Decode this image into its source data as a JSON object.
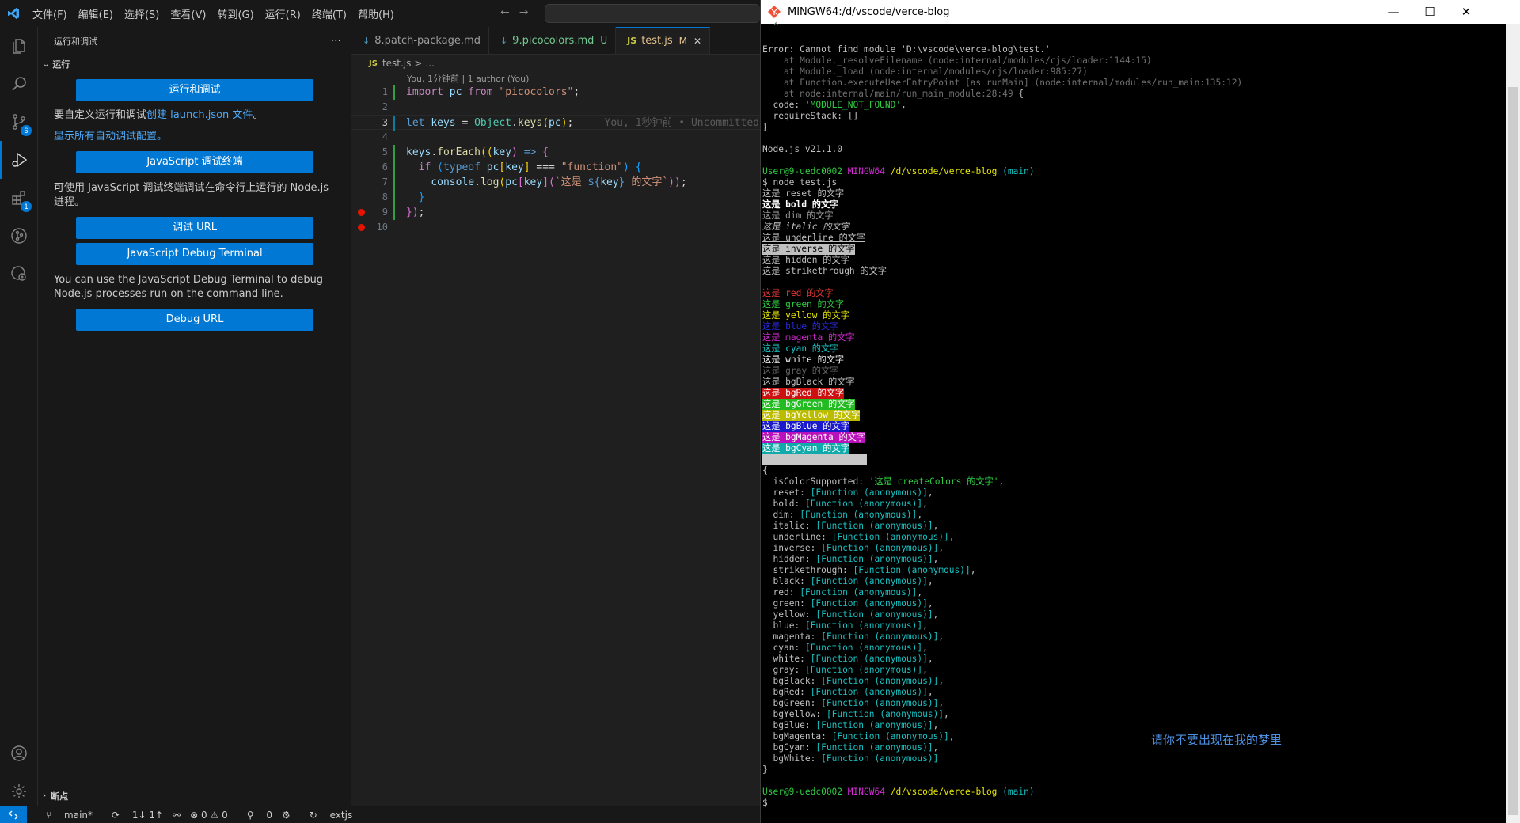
{
  "vscode": {
    "menu": [
      "文件(F)",
      "编辑(E)",
      "选择(S)",
      "查看(V)",
      "转到(G)",
      "运行(R)",
      "终端(T)",
      "帮助(H)"
    ],
    "nav": {
      "back": "←",
      "forward": "→"
    },
    "activity_badges": {
      "scm": "6",
      "extensions": "1"
    },
    "sidebar": {
      "title": "运行和调试",
      "more": "···",
      "section": "运行",
      "run_button": "运行和调试",
      "customize_text": "要自定义运行和调试",
      "customize_link": "创建 launch.json 文件",
      "customize_tail": "。",
      "show_all_link": "显示所有自动调试配置。",
      "js_terminal_button": "JavaScript 调试终端",
      "js_terminal_text": "可使用 JavaScript 调试终端调试在命令行上运行的 Node.js 进程。",
      "debug_url_button": "调试 URL",
      "js_debug_terminal_button": "JavaScript Debug Terminal",
      "js_debug_terminal_text": "You can use the JavaScript Debug Terminal to debug Node.js processes run on the command line.",
      "debug_url_button_en": "Debug URL",
      "breakpoints": "断点"
    },
    "tabs": [
      {
        "icon": "↓",
        "label": "8.patch-package.md",
        "status": ""
      },
      {
        "icon": "↓",
        "label": "9.picocolors.md",
        "status": "U"
      },
      {
        "icon": "JS",
        "label": "test.js",
        "status": "M",
        "close": "✕"
      }
    ],
    "breadcrumb": {
      "icon": "JS",
      "file": "test.js",
      "sep": ">",
      "rest": "..."
    },
    "codelens": "You, 1分钟前 | 1 author (You)",
    "line_numbers": [
      "1",
      "2",
      "3",
      "4",
      "5",
      "6",
      "7",
      "8",
      "9",
      "10"
    ],
    "code": {
      "l1": {
        "kw": "import",
        "id": "pc",
        "from": "from",
        "str": "\"picocolors\"",
        "end": ";"
      },
      "l3": {
        "kw": "let",
        "id": "keys",
        "eq": "=",
        "cls": "Object",
        "dot": ".",
        "fn": "keys",
        "o": "(",
        "arg": "pc",
        "c": ")",
        "end": ";",
        "blame": "You, 1秒钟前 • Uncommitted changes"
      },
      "l5": {
        "obj": "keys",
        "dot": ".",
        "fn": "forEach",
        "o1": "((",
        "arg": "key",
        "c1": ")",
        "arrow": "=>",
        "brace": "{"
      },
      "l6": {
        "kw": "if",
        "o": "(",
        "kw2": "typeof",
        "obj": "pc",
        "b1": "[",
        "arg": "key",
        "b2": "]",
        "op": "===",
        "str": "\"function\"",
        "c": ")",
        "brace": "{"
      },
      "l7": {
        "obj": "console",
        "dot": ".",
        "fn": "log",
        "o": "(",
        "pc": "pc",
        "b1": "[",
        "key": "key",
        "b2": "]",
        "o2": "(",
        "tpl1": "`这是 ",
        "tplo": "${",
        "tplk": "key",
        "tplc": "}",
        "tpl2": " 的文字`",
        "c2": "))",
        "end": ";"
      },
      "l8": {
        "brace": "}"
      },
      "l9": {
        "brace": "})",
        "end": ";"
      }
    },
    "status": {
      "branch": "main*",
      "sync": "1↓ 1↑",
      "problems": "⊗ 0 ⚠ 0",
      "ports": "0",
      "ext": "extjs"
    }
  },
  "terminal": {
    "title": "MINGW64:/d/vscode/verce-blog",
    "controls": {
      "min": "—",
      "max": "☐",
      "close": "✕"
    },
    "caret": "^",
    "error": {
      "l1": "Error: Cannot find module 'D:\\vscode\\verce-blog\\test.'",
      "l2": "    at Module._resolveFilename (node:internal/modules/cjs/loader:1144:15)",
      "l3": "    at Module._load (node:internal/modules/cjs/loader:985:27)",
      "l4": "    at Function.executeUserEntryPoint [as runMain] (node:internal/modules/run_main:135:12)",
      "l5a": "    at node:internal/main/run_main_module:28:49",
      "l5b": " {",
      "l6a": "  code: ",
      "l6b": "'MODULE_NOT_FOUND'",
      "l6c": ",",
      "l7": "  requireStack: []",
      "l8": "}"
    },
    "node_version": "Node.js v21.1.0",
    "prompt": {
      "user": "User@9-uedc0002",
      "host": "MINGW64",
      "path": "/d/vscode/verce-blog",
      "branch": "(main)",
      "dollar": "$"
    },
    "command": "$ node test.js",
    "styles": [
      "这是 reset 的文字",
      "这是 bold 的文字",
      "这是 dim 的文字",
      "这是 italic 的文字",
      "这是 underline 的文字",
      "这是 inverse 的文字",
      "这是 hidden 的文字",
      "这是 strikethrough 的文字"
    ],
    "colors": [
      "这是 red 的文字",
      "这是 green 的文字",
      "这是 yellow 的文字",
      "这是 blue 的文字",
      "这是 magenta 的文字",
      "这是 cyan 的文字",
      "这是 white 的文字",
      "这是 gray 的文字",
      "这是 bgBlack 的文字",
      "这是 bgRed 的文字",
      "这是 bgGreen 的文字",
      "这是 bgYellow 的文字",
      "这是 bgBlue 的文字",
      "这是 bgMagenta 的文字",
      "这是 bgCyan 的文字"
    ],
    "obj_open": "{",
    "is_color": {
      "key": "  isColorSupported: ",
      "val": "'这是 createColors 的文字'",
      "end": ","
    },
    "fn_keys": [
      "reset",
      "bold",
      "dim",
      "italic",
      "underline",
      "inverse",
      "hidden",
      "strikethrough",
      "black",
      "red",
      "green",
      "yellow",
      "blue",
      "magenta",
      "cyan",
      "white",
      "gray",
      "bgBlack",
      "bgRed",
      "bgGreen",
      "bgYellow",
      "bgBlue",
      "bgMagenta",
      "bgCyan",
      "bgWhite"
    ],
    "fn_value": "[Function (anonymous)]",
    "obj_close": "}",
    "final_prompt": "$",
    "lyric": "请你不要出现在我的梦里"
  }
}
